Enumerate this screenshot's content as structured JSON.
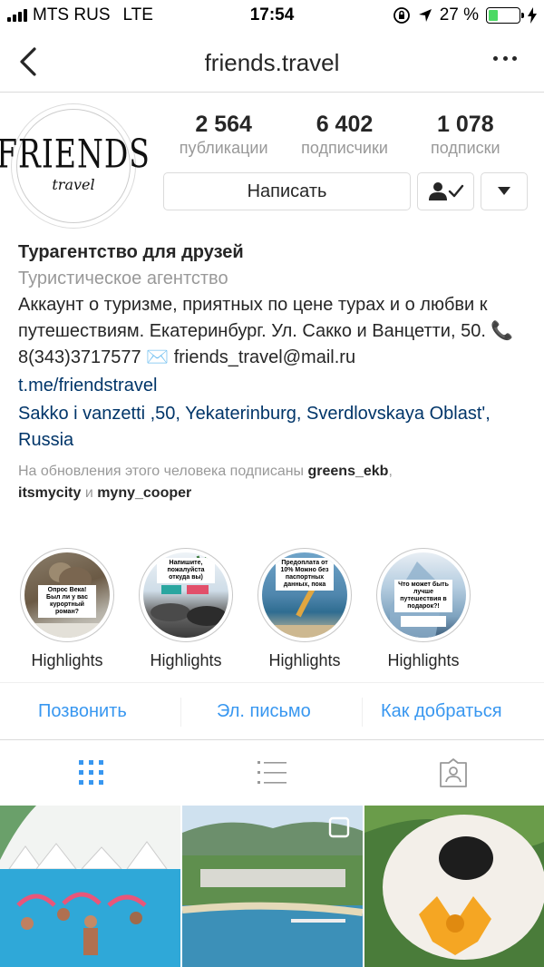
{
  "status_bar": {
    "carrier": "MTS RUS",
    "network": "LTE",
    "time": "17:54",
    "battery": "27 %",
    "battery_color": "#4cd964"
  },
  "navbar": {
    "back_icon": "chevron-left-icon",
    "title": "friends.travel",
    "more_icon": "more-horizontal-icon"
  },
  "profile": {
    "avatar_text": "FRIENDS",
    "avatar_subtext": "travel",
    "stats": [
      {
        "value": "2 564",
        "label": "публикации"
      },
      {
        "value": "6 402",
        "label": "подписчики"
      },
      {
        "value": "1 078",
        "label": "подписки"
      }
    ],
    "message_button": "Написать",
    "following_icon": "person-check-icon",
    "dropdown_icon": "caret-down-icon"
  },
  "bio": {
    "name": "Турагентство для друзей",
    "category": "Туристическое агентство",
    "description": "Аккаунт о туризме, приятных по цене турах и о любви к путешествиям. Екатеринбург. Ул. Сакко и Ванцетти, 50. 📞8(343)3717577 ✉️ friends_travel@mail.ru",
    "link": "t.me/friendstravel",
    "address": "Sakko i vanzetti ,50, Yekaterinburg, Sverdlovskaya Oblast', Russia",
    "followed_prefix": "На обновления этого человека подписаны ",
    "followed_user1": "greens_ekb",
    "followed_sep": ",",
    "followed_user2": "itsmycity",
    "followed_and": " и ",
    "followed_user3": "myny_cooper"
  },
  "highlights": [
    {
      "label": "Highlights",
      "sticker": "Опрос Века! Был ли у вас курортный роман?"
    },
    {
      "label": "Highlights",
      "sticker": "Напишите, пожалуйста откуда вы)"
    },
    {
      "label": "Highlights",
      "sticker": "Предоплата от 10% Можно без паспортных данных, пока"
    },
    {
      "label": "Highlights",
      "sticker": "Что может быть лучше путешествия в подарок?!"
    }
  ],
  "contacts": {
    "call": "Позвонить",
    "email": "Эл. письмо",
    "directions": "Как добраться",
    "link_color": "#3897f0"
  },
  "tabs": [
    {
      "icon": "grid-icon",
      "active": true
    },
    {
      "icon": "list-icon",
      "active": false
    },
    {
      "icon": "tagged-user-icon",
      "active": false
    }
  ],
  "grid": [
    {
      "description": "pool-water-aerobics-photo"
    },
    {
      "description": "resort-coast-aerial-photo",
      "icon": "multiple-posts-icon"
    },
    {
      "description": "dog-with-flower-photo"
    }
  ]
}
